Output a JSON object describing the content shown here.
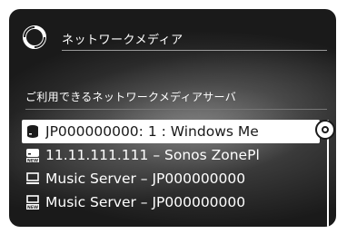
{
  "header": {
    "title": "ネットワークメディア",
    "icon": "network-media-icon"
  },
  "section": {
    "title": "ご利用できるネットワークメディアサーバ"
  },
  "servers": [
    {
      "label": "JP000000000: 1 : Windows Me",
      "icon": "storage-drive-icon",
      "selected": true
    },
    {
      "label": "11.11.111.111 – Sonos ZonePl",
      "icon": "new-server-icon",
      "selected": false
    },
    {
      "label": "Music Server – JP000000000",
      "icon": "computer-monitor-icon",
      "selected": false
    },
    {
      "label": "Music Server – JP000000000",
      "icon": "new-computer-icon",
      "selected": false
    }
  ],
  "colors": {
    "background": "#2a2a2a",
    "text": "#ffffff",
    "selection": "#ffffff"
  }
}
